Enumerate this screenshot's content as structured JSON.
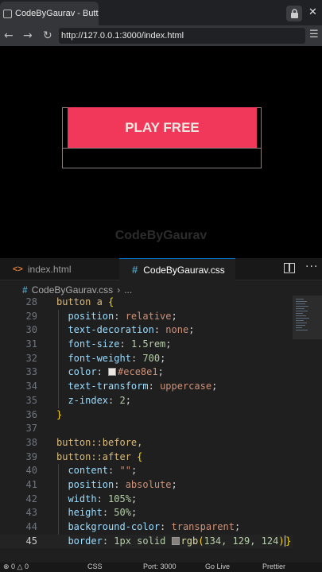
{
  "browser": {
    "tab_title": "CodeByGaurav - Button",
    "url": "http://127.0.0.1:3000/index.html",
    "icons": {
      "tab": "window-icon",
      "lock": "lock-icon",
      "close": "close-icon",
      "back": "back-icon",
      "forward": "forward-icon",
      "reload": "reload-icon",
      "menu": "menu-icon"
    }
  },
  "page": {
    "button_label": "PLAY FREE",
    "watermark": "CodeByGaurav",
    "colors": {
      "button_bg": "#f2385a",
      "button_text": "#ece8e1",
      "outline": "#867d7c"
    }
  },
  "editor": {
    "tabs": [
      {
        "label": "index.html",
        "icon": "<>"
      },
      {
        "label": "CodeByGaurav.css",
        "icon": "#"
      }
    ],
    "breadcrumb": {
      "file": "CodeByGaurav.css",
      "sep": "›",
      "rest": "..."
    },
    "code": {
      "l28": {
        "n": "28",
        "sel": "button a",
        "brace": " {"
      },
      "l29": {
        "n": "29",
        "prop": "position",
        "val": "relative"
      },
      "l30": {
        "n": "30",
        "prop": "text-decoration",
        "val": "none"
      },
      "l31": {
        "n": "31",
        "prop": "font-size",
        "val": "1.5rem"
      },
      "l32": {
        "n": "32",
        "prop": "font-weight",
        "val": "700"
      },
      "l33": {
        "n": "33",
        "prop": "color",
        "val": "#ece8e1"
      },
      "l34": {
        "n": "34",
        "prop": "text-transform",
        "val": "uppercase"
      },
      "l35": {
        "n": "35",
        "prop": "z-index",
        "val": "2"
      },
      "l36": {
        "n": "36",
        "brace": "}"
      },
      "l37": {
        "n": "37"
      },
      "l38": {
        "n": "38",
        "sel": "button::before,"
      },
      "l39": {
        "n": "39",
        "sel": "button::after",
        "brace": " {"
      },
      "l40": {
        "n": "40",
        "prop": "content",
        "val": "\"\""
      },
      "l41": {
        "n": "41",
        "prop": "position",
        "val": "absolute"
      },
      "l42": {
        "n": "42",
        "prop": "width",
        "val": "105%"
      },
      "l43": {
        "n": "43",
        "prop": "height",
        "val": "50%"
      },
      "l44": {
        "n": "44",
        "prop": "background-color",
        "val": "transparent"
      },
      "l45": {
        "n": "45",
        "prop": "border",
        "val1": "1px solid ",
        "fn": "rgb",
        "args": "134, 129, 124"
      }
    },
    "swatches": {
      "color_line": "#ece8e1",
      "border_line": "#86817c"
    }
  },
  "statusbar": {
    "errors": "⊗ 0 △ 0",
    "lang": "CSS",
    "port": "Port: 3000",
    "golive": "Go Live",
    "prettier": "Prettier"
  }
}
